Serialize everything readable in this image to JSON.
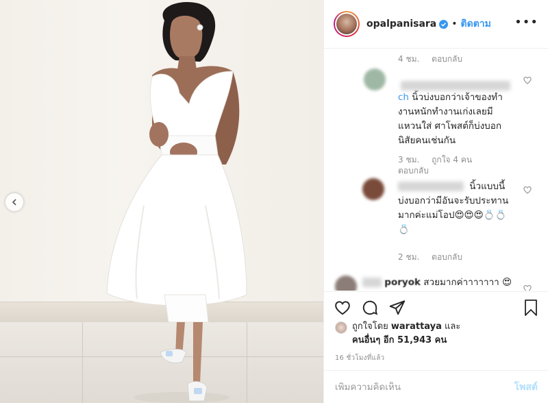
{
  "post": {
    "username": "opalpanisara",
    "separator": "•",
    "follow_label": "ติดตาม",
    "more_label": "•••"
  },
  "comments": [
    {
      "kind": "tail",
      "time": "4 ชม.",
      "reply": "ตอบกลับ"
    },
    {
      "kind": "full",
      "handle": "ch",
      "lines": [
        "นิ้วบ่งบอกว่าเจ้าของทำ",
        "งานหนักทำงานเก่งเลยมี",
        "แหวนใส่ ศาโพสต์ก็บ่งบอก",
        "นิสัยคนเช่นกัน"
      ],
      "time": "3 ชม.",
      "likes": "ถูกใจ 4 คน",
      "reply": "ตอบกลับ"
    },
    {
      "kind": "full",
      "handle": "",
      "lines": [
        "นิ้วแบบนี้",
        "บ่งบอกว่ามีอันจะรับประทาน",
        "มากค่ะแม่โอป😍😍😍💍💍",
        "💍"
      ],
      "time": "2 ชม.",
      "reply": "ตอบกลับ"
    },
    {
      "kind": "partial",
      "handle": "poryok",
      "text": "สวยมากค่าาาาาาา 😍"
    }
  ],
  "likes": {
    "prefix": "ถูกใจโดย",
    "user": "warattaya",
    "and": "และ",
    "others": "คนอื่นๆ อีก 51,943 คน"
  },
  "timestamp": "16 ชั่วโมงที่แล้ว",
  "add_comment": {
    "placeholder": "เพิ่มความคิดเห็น",
    "post_label": "โพสต์"
  },
  "colors": {
    "accent": "#3897f0",
    "post_disabled": "#b2dffc",
    "muted": "#8e8e8e"
  },
  "icons": [
    "chevron-left-icon",
    "verified-badge-icon",
    "more-icon",
    "heart-icon",
    "comment-icon",
    "share-icon",
    "bookmark-icon"
  ]
}
